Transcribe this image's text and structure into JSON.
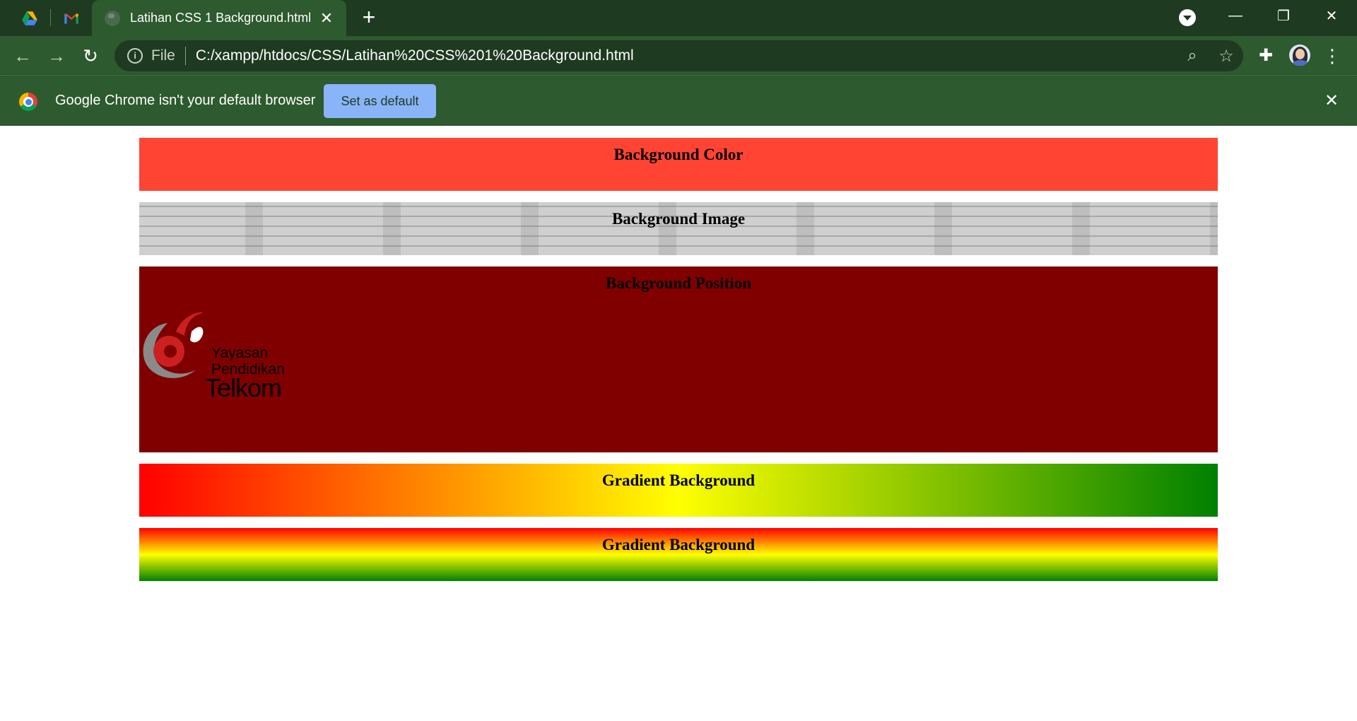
{
  "browser": {
    "tab": {
      "title": "Latihan CSS 1 Background.html",
      "close": "✕"
    },
    "new_tab": "+",
    "window_controls": {
      "minimize": "—",
      "restore": "❐",
      "close": "✕"
    },
    "address": {
      "scheme_label": "File",
      "url": "C:/xampp/htdocs/CSS/Latihan%20CSS%201%20Background.html"
    },
    "infobar": {
      "message": "Google Chrome isn't your default browser",
      "button": "Set as default",
      "close": "✕"
    }
  },
  "page": {
    "sections": [
      {
        "heading": "Background Color",
        "background": "#ff4433"
      },
      {
        "heading": "Background Image",
        "background": "#b4b4b4"
      },
      {
        "heading": "Background Position",
        "background": "#800000"
      },
      {
        "heading": "Gradient Background",
        "gradient": [
          "#ff0000",
          "#ffff00",
          "#008000"
        ],
        "direction": "to right"
      },
      {
        "heading": "Gradient Background",
        "gradient": [
          "#ff0000",
          "#ffff00",
          "#008000"
        ],
        "direction": "to bottom"
      }
    ],
    "logo": {
      "line1": "Yayasan",
      "line2": "Pendidikan",
      "line3": "Telkom"
    }
  },
  "colors": {
    "frame_dark": "#1e3a20",
    "frame": "#2d5a2e",
    "accent_button": "#8ab4f8"
  },
  "icons": {
    "pinned": [
      "google-drive-icon",
      "gmail-icon"
    ],
    "toolbar": [
      "back-icon",
      "forward-icon",
      "reload-icon",
      "info-icon",
      "zoom-icon",
      "star-icon",
      "extensions-icon",
      "avatar",
      "kebab-menu-icon"
    ]
  }
}
